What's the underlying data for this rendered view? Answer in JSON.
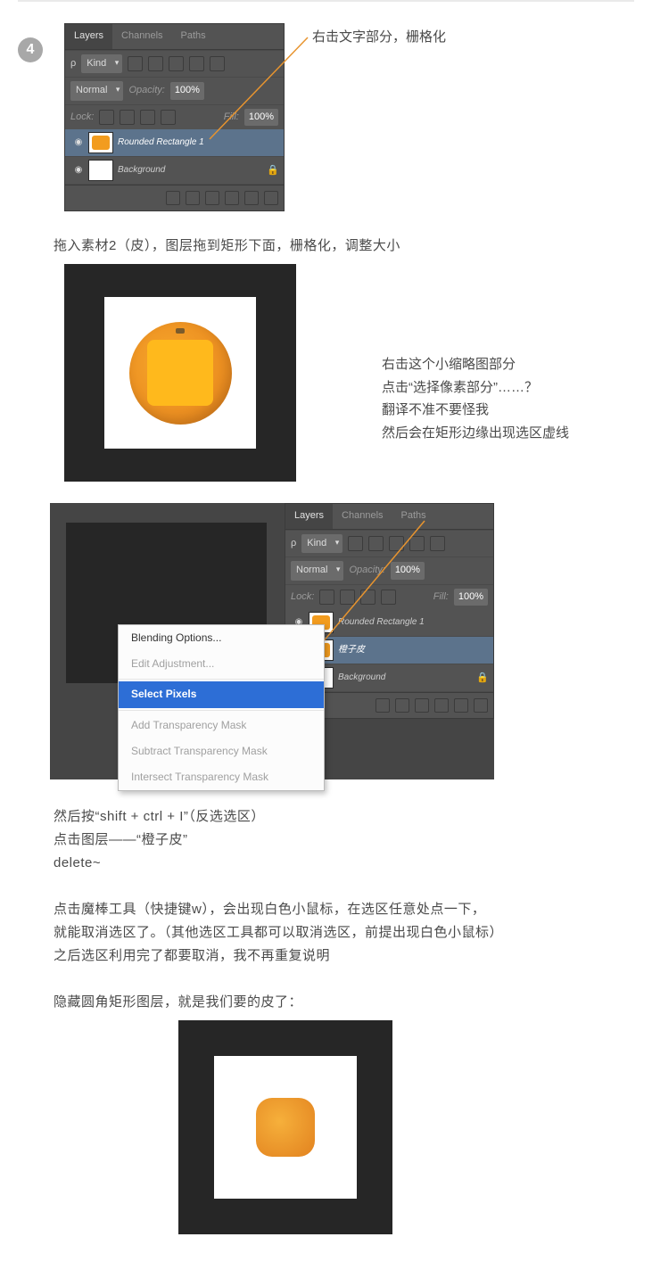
{
  "step_number": "4",
  "annotations": {
    "top": "右击文字部分，栅格化",
    "side_block": {
      "l1": "右击这个小缩略图部分",
      "l2": "点击“选择像素部分”……？",
      "l3": "翻译不准不要怪我",
      "l4": "然后会在矩形边缘出现选区虚线"
    }
  },
  "ps_panel": {
    "tabs": [
      "Layers",
      "Channels",
      "Paths"
    ],
    "filter_label": "Kind",
    "blend_mode": "Normal",
    "opacity_label": "Opacity:",
    "opacity_value": "100%",
    "lock_label": "Lock:",
    "fill_label": "Fill:",
    "fill_value": "100%",
    "layers_a": [
      {
        "name": "Rounded Rectangle 1",
        "selected": true,
        "locked": false,
        "orange": true
      },
      {
        "name": "Background",
        "selected": false,
        "locked": true,
        "orange": false
      }
    ],
    "layers_b": [
      {
        "name": "Rounded Rectangle 1",
        "selected": false,
        "locked": false,
        "orange": true
      },
      {
        "name": "橙子皮",
        "selected": true,
        "locked": false,
        "orange": true
      },
      {
        "name": "Background",
        "selected": false,
        "locked": true,
        "orange": false
      }
    ]
  },
  "context_menu": {
    "items": [
      {
        "label": "Blending Options...",
        "type": "normal"
      },
      {
        "label": "Edit Adjustment...",
        "type": "gray"
      },
      {
        "label": "sep",
        "type": "sep"
      },
      {
        "label": "Select Pixels",
        "type": "highlight"
      },
      {
        "label": "sep",
        "type": "sep"
      },
      {
        "label": "Add Transparency Mask",
        "type": "gray"
      },
      {
        "label": "Subtract Transparency Mask",
        "type": "gray"
      },
      {
        "label": "Intersect Transparency Mask",
        "type": "gray"
      }
    ]
  },
  "text": {
    "p1": "拖入素材2（皮），图层拖到矩形下面，栅格化，调整大小",
    "p2a": "然后按“shift + ctrl + I”（反选选区）",
    "p2b": "点击图层——“橙子皮”",
    "p2c": "delete~",
    "p3a": "点击魔棒工具（快捷键w），会出现白色小鼠标，在选区任意处点一下，",
    "p3b": "就能取消选区了。（其他选区工具都可以取消选区，前提出现白色小鼠标）",
    "p3c": "之后选区利用完了都要取消，我不再重复说明",
    "p4": "隐藏圆角矩形图层，就是我们要的皮了："
  }
}
